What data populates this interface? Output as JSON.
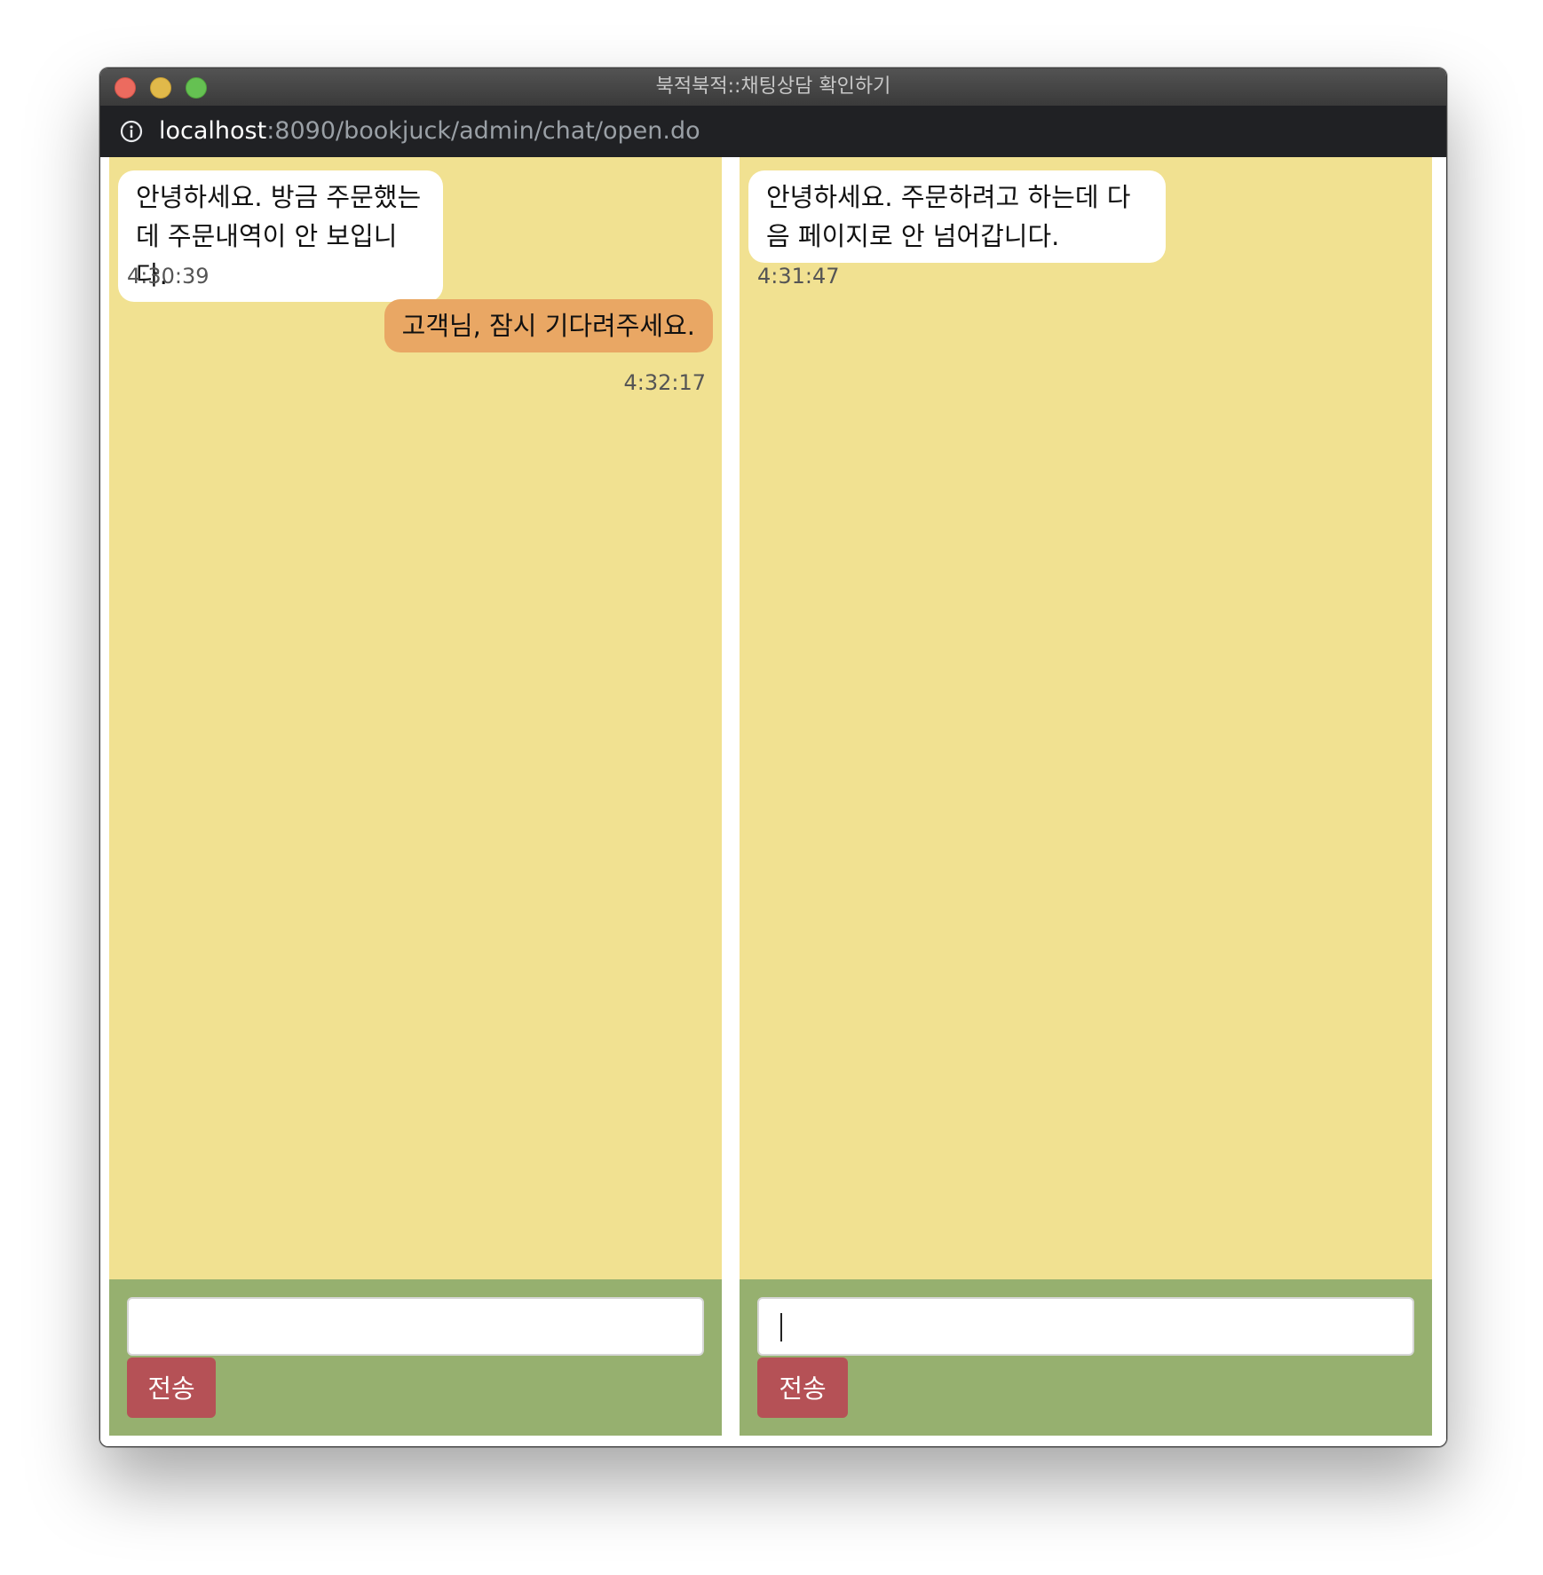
{
  "window": {
    "title": "북적북적::채팅상담 확인하기"
  },
  "address_bar": {
    "host": "localhost",
    "path": ":8090/bookjuck/admin/chat/open.do",
    "icon": "info-icon"
  },
  "chats": [
    {
      "messages": [
        {
          "direction": "incoming",
          "text": "안녕하세요. 방금 주문했는데 주문내역이 안 보입니다.",
          "time": "4:30:39"
        },
        {
          "direction": "outgoing",
          "text": "고객님, 잠시 기다려주세요.",
          "time": "4:32:17"
        }
      ],
      "input_value": "",
      "send_label": "전송"
    },
    {
      "messages": [
        {
          "direction": "incoming",
          "text": "안녕하세요. 주문하려고 하는데 다음 페이지로 안 넘어갑니다.",
          "time": "4:31:47"
        }
      ],
      "input_value": "",
      "send_label": "전송"
    }
  ],
  "colors": {
    "chat_background": "#f1e191",
    "composer_background": "#96b06f",
    "incoming_bubble": "#ffffff",
    "outgoing_bubble": "#e9a764",
    "send_button": "#b55156"
  }
}
